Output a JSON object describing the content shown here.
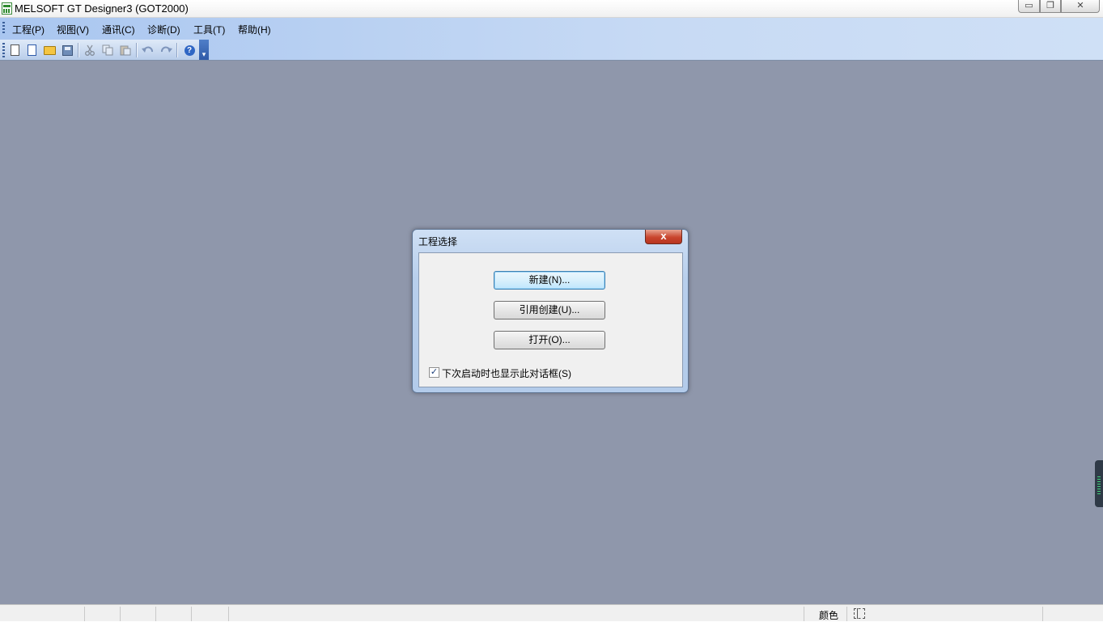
{
  "window": {
    "title": "MELSOFT GT Designer3 (GOT2000)",
    "min_symbol": "▭",
    "max_symbol": "❐",
    "close_symbol": "✕"
  },
  "menu": {
    "items": [
      {
        "label": "工程(P)"
      },
      {
        "label": "视图(V)"
      },
      {
        "label": "通讯(C)"
      },
      {
        "label": "诊断(D)"
      },
      {
        "label": "工具(T)"
      },
      {
        "label": "帮助(H)"
      }
    ]
  },
  "toolbar": {
    "buttons": [
      "new-icon",
      "import-icon",
      "open-folder-icon",
      "save-icon",
      "cut-icon",
      "copy-icon",
      "paste-icon",
      "undo-icon",
      "redo-icon",
      "help-icon"
    ],
    "help_glyph": "?",
    "more_glyph": "▾"
  },
  "dialog": {
    "title": "工程选择",
    "close_glyph": "x",
    "buttons": {
      "new_label": "新建(N)...",
      "new_from_label": "引用创建(U)...",
      "open_label": "打开(O)..."
    },
    "checkbox": {
      "checked": true,
      "mark": "✓",
      "label": "下次启动时也显示此对话框(S)"
    }
  },
  "statusbar": {
    "color_label": "颜色"
  },
  "colors": {
    "workspace_bg": "#8f97ab",
    "menubar_bg": "#b9d1f0",
    "dialog_frame": "#b8cfec",
    "close_red": "#c9452e"
  }
}
